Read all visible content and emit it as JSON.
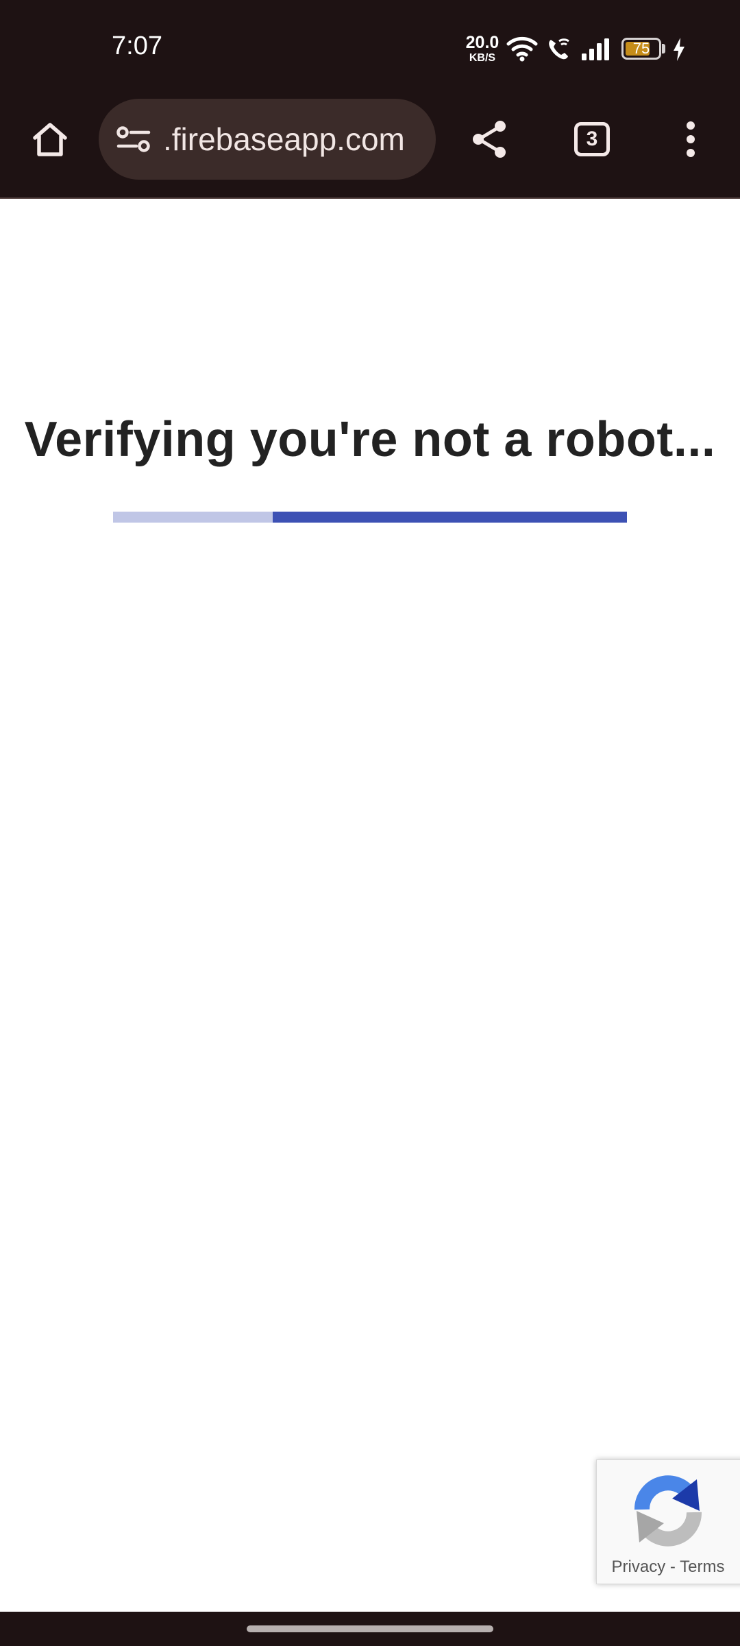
{
  "status_bar": {
    "time": "7:07",
    "net_speed_value": "20.0",
    "net_speed_unit": "KB/S",
    "battery_level": "75",
    "battery_fraction": 0.75
  },
  "browser": {
    "url": ".firebaseapp.com",
    "tab_count": "3",
    "icons": [
      "home-icon",
      "site-info-icon",
      "share-icon",
      "tabs-icon",
      "more-vert-icon"
    ]
  },
  "page": {
    "heading": "Verifying you're not a robot...",
    "progress_fraction": 0.69,
    "colors": {
      "progress_track": "#c0c6e6",
      "progress_fill": "#3d51b4"
    }
  },
  "recaptcha": {
    "privacy_label": "Privacy",
    "separator": "-",
    "terms_label": "Terms"
  }
}
